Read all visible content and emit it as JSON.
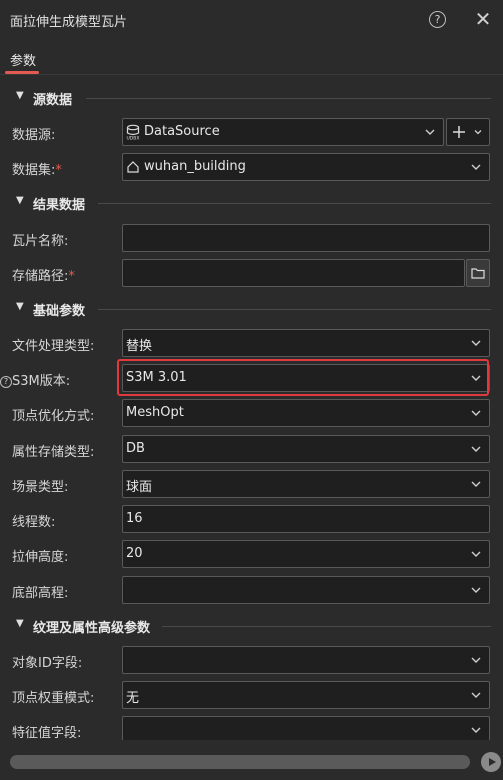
{
  "window": {
    "title": "面拉伸生成模型瓦片"
  },
  "tabs": {
    "active": "参数"
  },
  "sections": {
    "source": "源数据",
    "result": "结果数据",
    "basic": "基础参数",
    "texture": "纹理及属性高级参数"
  },
  "source": {
    "datasource_label": "数据源:",
    "datasource_value": "DataSource",
    "dataset_label": "数据集:",
    "dataset_value": "wuhan_building"
  },
  "result": {
    "tile_name_label": "瓦片名称:",
    "tile_name_value": "",
    "storage_path_label": "存储路径:",
    "storage_path_value": ""
  },
  "basic": {
    "file_mode_label": "文件处理类型:",
    "file_mode_value": "替换",
    "s3m_version_label": "S3M版本:",
    "s3m_version_value": "S3M 3.01",
    "vertex_opt_label": "顶点优化方式:",
    "vertex_opt_value": "MeshOpt",
    "attr_storage_label": "属性存储类型:",
    "attr_storage_value": "DB",
    "scene_type_label": "场景类型:",
    "scene_type_value": "球面",
    "threads_label": "线程数:",
    "threads_value": "16",
    "extrude_height_label": "拉伸高度:",
    "extrude_height_value": "20",
    "bottom_elev_label": "底部高程:",
    "bottom_elev_value": ""
  },
  "texture": {
    "object_id_label": "对象ID字段:",
    "object_id_value": "",
    "vertex_weight_label": "顶点权重模式:",
    "vertex_weight_value": "无",
    "feature_value_label": "特征值字段:",
    "feature_value_value": ""
  },
  "colors": {
    "accent": "#e35a52",
    "highlight": "#e0393e",
    "background": "#2b2b2b"
  }
}
